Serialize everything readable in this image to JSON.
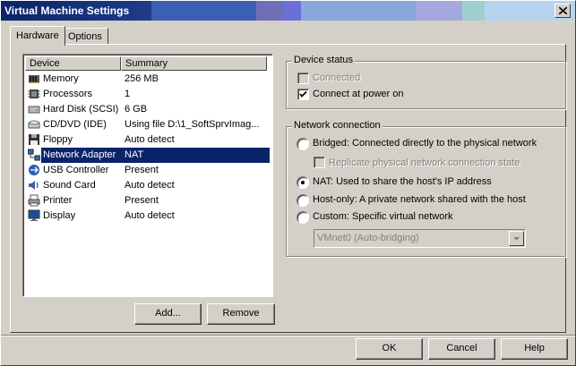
{
  "window": {
    "title": "Virtual Machine Settings"
  },
  "tabs": [
    {
      "label": "Hardware"
    },
    {
      "label": "Options"
    }
  ],
  "device_list": {
    "headers": {
      "device": "Device",
      "summary": "Summary"
    },
    "rows": [
      {
        "icon": "memory-icon",
        "device": "Memory",
        "summary": "256 MB"
      },
      {
        "icon": "processor-icon",
        "device": "Processors",
        "summary": "1"
      },
      {
        "icon": "hard-disk-icon",
        "device": "Hard Disk (SCSI)",
        "summary": "6 GB"
      },
      {
        "icon": "cd-dvd-icon",
        "device": "CD/DVD (IDE)",
        "summary": "Using file D:\\1_SoftSprvImag..."
      },
      {
        "icon": "floppy-icon",
        "device": "Floppy",
        "summary": "Auto detect"
      },
      {
        "icon": "network-adapter-icon",
        "device": "Network Adapter",
        "summary": "NAT",
        "selected": true
      },
      {
        "icon": "usb-icon",
        "device": "USB Controller",
        "summary": "Present"
      },
      {
        "icon": "sound-card-icon",
        "device": "Sound Card",
        "summary": "Auto detect"
      },
      {
        "icon": "printer-icon",
        "device": "Printer",
        "summary": "Present"
      },
      {
        "icon": "display-icon",
        "device": "Display",
        "summary": "Auto detect"
      }
    ]
  },
  "list_buttons": {
    "add": "Add...",
    "remove": "Remove"
  },
  "device_status": {
    "title": "Device status",
    "connected": {
      "label": "Connected",
      "checked": false,
      "enabled": false
    },
    "connect_at_power_on": {
      "label": "Connect at power on",
      "checked": true,
      "enabled": true
    }
  },
  "network_connection": {
    "title": "Network connection",
    "options": [
      {
        "label": "Bridged: Connected directly to the physical network",
        "selected": false
      },
      {
        "label": "NAT: Used to share the host's IP address",
        "selected": true
      },
      {
        "label": "Host-only: A private network shared with the host",
        "selected": false
      },
      {
        "label": "Custom: Specific virtual network",
        "selected": false
      }
    ],
    "replicate": {
      "label": "Replicate physical network connection state",
      "checked": false,
      "enabled": false
    },
    "custom_network_select": {
      "value": "VMnet0 (Auto-bridging)",
      "enabled": false
    }
  },
  "footer_buttons": {
    "ok": "OK",
    "cancel": "Cancel",
    "help": "Help"
  },
  "colors": {
    "title_bar": "#0a246a",
    "selection": "#0a246a",
    "face": "#d4d0c8"
  }
}
